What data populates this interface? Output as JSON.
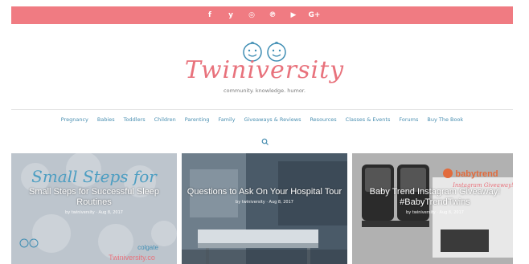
{
  "social": {
    "icons": [
      {
        "name": "facebook-icon",
        "glyph": "f"
      },
      {
        "name": "twitter-icon",
        "glyph": "y"
      },
      {
        "name": "instagram-icon",
        "glyph": "◎"
      },
      {
        "name": "pinterest-icon",
        "glyph": "℗"
      },
      {
        "name": "youtube-icon",
        "glyph": "▶"
      },
      {
        "name": "googleplus-icon",
        "glyph": "G+"
      }
    ]
  },
  "logo": {
    "title": "Twiniversity",
    "tagline": "community. knowledge. humor."
  },
  "nav": {
    "items": [
      "Pregnancy",
      "Babies",
      "Toddlers",
      "Children",
      "Parenting",
      "Family",
      "Giveaways & Reviews",
      "Resources",
      "Classes & Events",
      "Forums",
      "Buy The Book"
    ]
  },
  "slides": [
    {
      "title": "Small Steps for Successful Sleep Routines",
      "meta": "by twiniversity · Aug 8, 2017",
      "overlay_text": "Small Steps for",
      "brand": "colgate",
      "site": "Twiniversity.co"
    },
    {
      "title": "Questions to Ask On Your Hospital Tour",
      "meta": "by twiniversity · Aug 8, 2017"
    },
    {
      "title": "Baby Trend Instagram Giveaway! #BabyTrendTwins",
      "meta": "by twiniversity · Aug 8, 2017",
      "brand": "babytrend",
      "promo": "Instagram Giveaway!"
    }
  ],
  "colors": {
    "accent": "#f07b82",
    "nav_link": "#4a8fb1",
    "logo": "#e8727c"
  }
}
